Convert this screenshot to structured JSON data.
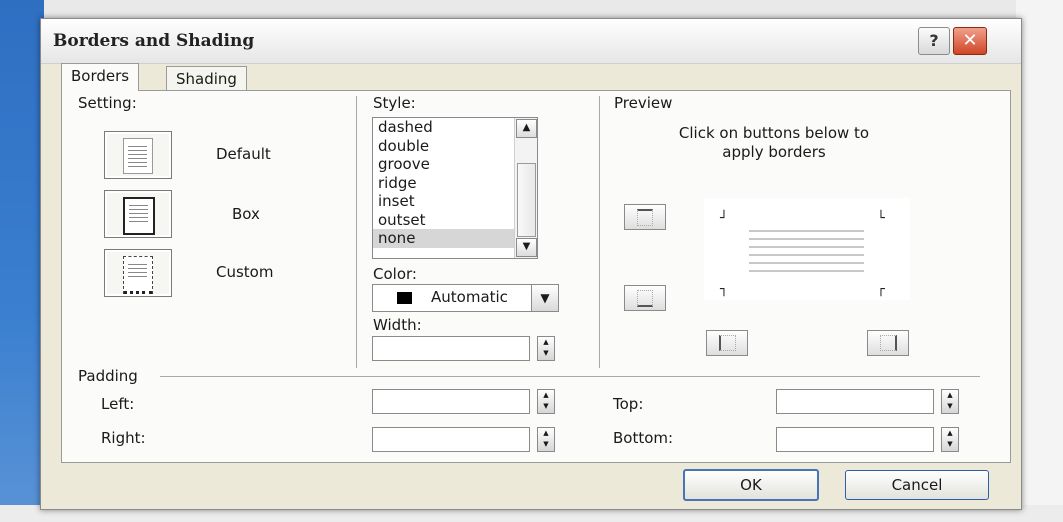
{
  "dialog": {
    "title": "Borders and Shading",
    "help_label": "?",
    "close_label": "✕"
  },
  "tabs": [
    {
      "label": "Borders"
    },
    {
      "label": "Shading"
    }
  ],
  "setting": {
    "heading": "Setting:",
    "options": [
      {
        "label": "Default"
      },
      {
        "label": "Box"
      },
      {
        "label": "Custom"
      }
    ]
  },
  "style": {
    "heading": "Style:",
    "items": [
      "dashed",
      "double",
      "groove",
      "ridge",
      "inset",
      "outset",
      "none"
    ],
    "selected": "none"
  },
  "color": {
    "heading": "Color:",
    "value": "Automatic",
    "swatch": "#000000"
  },
  "width": {
    "heading": "Width:",
    "value": ""
  },
  "preview": {
    "heading": "Preview",
    "hint": "Click on buttons below to apply borders"
  },
  "padding": {
    "heading": "Padding",
    "left_label": "Left:",
    "right_label": "Right:",
    "top_label": "Top:",
    "bottom_label": "Bottom:",
    "left": "",
    "right": "",
    "top": "",
    "bottom": ""
  },
  "buttons": {
    "ok": "OK",
    "cancel": "Cancel"
  },
  "colors": {
    "dialog_bg": "#ece9d8",
    "close_red": "#d04526",
    "accent_blue": "#2c5fa8"
  }
}
